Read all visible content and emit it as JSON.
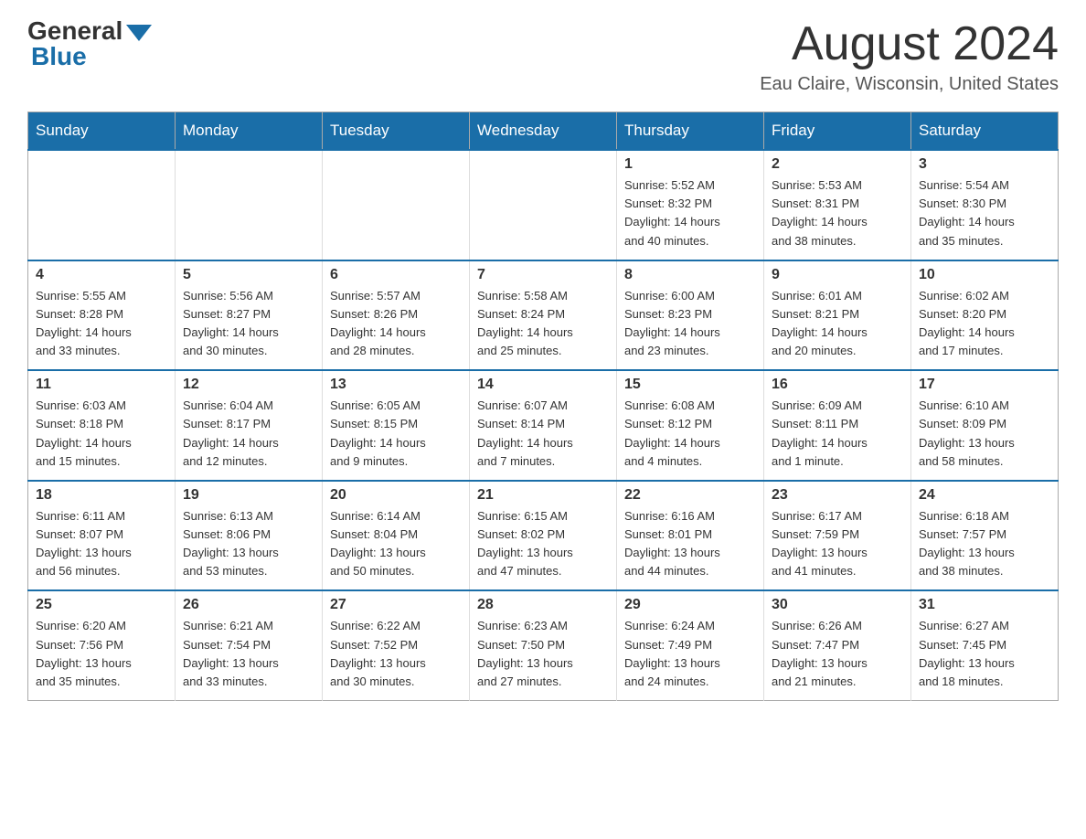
{
  "logo": {
    "general": "General",
    "blue": "Blue"
  },
  "header": {
    "month_title": "August 2024",
    "location": "Eau Claire, Wisconsin, United States"
  },
  "days_of_week": [
    "Sunday",
    "Monday",
    "Tuesday",
    "Wednesday",
    "Thursday",
    "Friday",
    "Saturday"
  ],
  "weeks": [
    [
      {
        "day": "",
        "info": ""
      },
      {
        "day": "",
        "info": ""
      },
      {
        "day": "",
        "info": ""
      },
      {
        "day": "",
        "info": ""
      },
      {
        "day": "1",
        "info": "Sunrise: 5:52 AM\nSunset: 8:32 PM\nDaylight: 14 hours\nand 40 minutes."
      },
      {
        "day": "2",
        "info": "Sunrise: 5:53 AM\nSunset: 8:31 PM\nDaylight: 14 hours\nand 38 minutes."
      },
      {
        "day": "3",
        "info": "Sunrise: 5:54 AM\nSunset: 8:30 PM\nDaylight: 14 hours\nand 35 minutes."
      }
    ],
    [
      {
        "day": "4",
        "info": "Sunrise: 5:55 AM\nSunset: 8:28 PM\nDaylight: 14 hours\nand 33 minutes."
      },
      {
        "day": "5",
        "info": "Sunrise: 5:56 AM\nSunset: 8:27 PM\nDaylight: 14 hours\nand 30 minutes."
      },
      {
        "day": "6",
        "info": "Sunrise: 5:57 AM\nSunset: 8:26 PM\nDaylight: 14 hours\nand 28 minutes."
      },
      {
        "day": "7",
        "info": "Sunrise: 5:58 AM\nSunset: 8:24 PM\nDaylight: 14 hours\nand 25 minutes."
      },
      {
        "day": "8",
        "info": "Sunrise: 6:00 AM\nSunset: 8:23 PM\nDaylight: 14 hours\nand 23 minutes."
      },
      {
        "day": "9",
        "info": "Sunrise: 6:01 AM\nSunset: 8:21 PM\nDaylight: 14 hours\nand 20 minutes."
      },
      {
        "day": "10",
        "info": "Sunrise: 6:02 AM\nSunset: 8:20 PM\nDaylight: 14 hours\nand 17 minutes."
      }
    ],
    [
      {
        "day": "11",
        "info": "Sunrise: 6:03 AM\nSunset: 8:18 PM\nDaylight: 14 hours\nand 15 minutes."
      },
      {
        "day": "12",
        "info": "Sunrise: 6:04 AM\nSunset: 8:17 PM\nDaylight: 14 hours\nand 12 minutes."
      },
      {
        "day": "13",
        "info": "Sunrise: 6:05 AM\nSunset: 8:15 PM\nDaylight: 14 hours\nand 9 minutes."
      },
      {
        "day": "14",
        "info": "Sunrise: 6:07 AM\nSunset: 8:14 PM\nDaylight: 14 hours\nand 7 minutes."
      },
      {
        "day": "15",
        "info": "Sunrise: 6:08 AM\nSunset: 8:12 PM\nDaylight: 14 hours\nand 4 minutes."
      },
      {
        "day": "16",
        "info": "Sunrise: 6:09 AM\nSunset: 8:11 PM\nDaylight: 14 hours\nand 1 minute."
      },
      {
        "day": "17",
        "info": "Sunrise: 6:10 AM\nSunset: 8:09 PM\nDaylight: 13 hours\nand 58 minutes."
      }
    ],
    [
      {
        "day": "18",
        "info": "Sunrise: 6:11 AM\nSunset: 8:07 PM\nDaylight: 13 hours\nand 56 minutes."
      },
      {
        "day": "19",
        "info": "Sunrise: 6:13 AM\nSunset: 8:06 PM\nDaylight: 13 hours\nand 53 minutes."
      },
      {
        "day": "20",
        "info": "Sunrise: 6:14 AM\nSunset: 8:04 PM\nDaylight: 13 hours\nand 50 minutes."
      },
      {
        "day": "21",
        "info": "Sunrise: 6:15 AM\nSunset: 8:02 PM\nDaylight: 13 hours\nand 47 minutes."
      },
      {
        "day": "22",
        "info": "Sunrise: 6:16 AM\nSunset: 8:01 PM\nDaylight: 13 hours\nand 44 minutes."
      },
      {
        "day": "23",
        "info": "Sunrise: 6:17 AM\nSunset: 7:59 PM\nDaylight: 13 hours\nand 41 minutes."
      },
      {
        "day": "24",
        "info": "Sunrise: 6:18 AM\nSunset: 7:57 PM\nDaylight: 13 hours\nand 38 minutes."
      }
    ],
    [
      {
        "day": "25",
        "info": "Sunrise: 6:20 AM\nSunset: 7:56 PM\nDaylight: 13 hours\nand 35 minutes."
      },
      {
        "day": "26",
        "info": "Sunrise: 6:21 AM\nSunset: 7:54 PM\nDaylight: 13 hours\nand 33 minutes."
      },
      {
        "day": "27",
        "info": "Sunrise: 6:22 AM\nSunset: 7:52 PM\nDaylight: 13 hours\nand 30 minutes."
      },
      {
        "day": "28",
        "info": "Sunrise: 6:23 AM\nSunset: 7:50 PM\nDaylight: 13 hours\nand 27 minutes."
      },
      {
        "day": "29",
        "info": "Sunrise: 6:24 AM\nSunset: 7:49 PM\nDaylight: 13 hours\nand 24 minutes."
      },
      {
        "day": "30",
        "info": "Sunrise: 6:26 AM\nSunset: 7:47 PM\nDaylight: 13 hours\nand 21 minutes."
      },
      {
        "day": "31",
        "info": "Sunrise: 6:27 AM\nSunset: 7:45 PM\nDaylight: 13 hours\nand 18 minutes."
      }
    ]
  ]
}
